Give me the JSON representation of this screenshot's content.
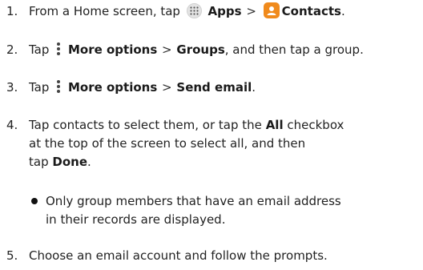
{
  "steps": [
    {
      "num": "1.",
      "pre": "From a Home screen, tap",
      "apps_label": "Apps",
      "sep": ">",
      "contacts_label": "Contacts",
      "post": "."
    },
    {
      "num": "2.",
      "pre": "Tap",
      "more_label": "More options",
      "sep": ">",
      "groups_label": "Groups",
      "post": ", and then tap a group."
    },
    {
      "num": "3.",
      "pre": "Tap",
      "more_label": "More options",
      "sep": ">",
      "send_label": "Send email",
      "post": "."
    },
    {
      "num": "4.",
      "line1_pre": "Tap contacts to select them, or tap the",
      "all_label": "All",
      "line1_post": "checkbox",
      "line2": "at the top of the screen to select all, and then",
      "line3_pre": "tap",
      "done_label": "Done",
      "line3_post": "."
    },
    {
      "num": "5.",
      "text": "Choose an email account and follow the prompts."
    }
  ],
  "note": {
    "line1": "Only group members that have an email address",
    "line2": "in their records are displayed."
  },
  "icons": {
    "apps": "apps-grid-icon",
    "contacts": "contacts-app-icon",
    "more": "more-options-icon"
  },
  "colors": {
    "contacts_icon": "#f08a1c",
    "text": "#222222"
  }
}
